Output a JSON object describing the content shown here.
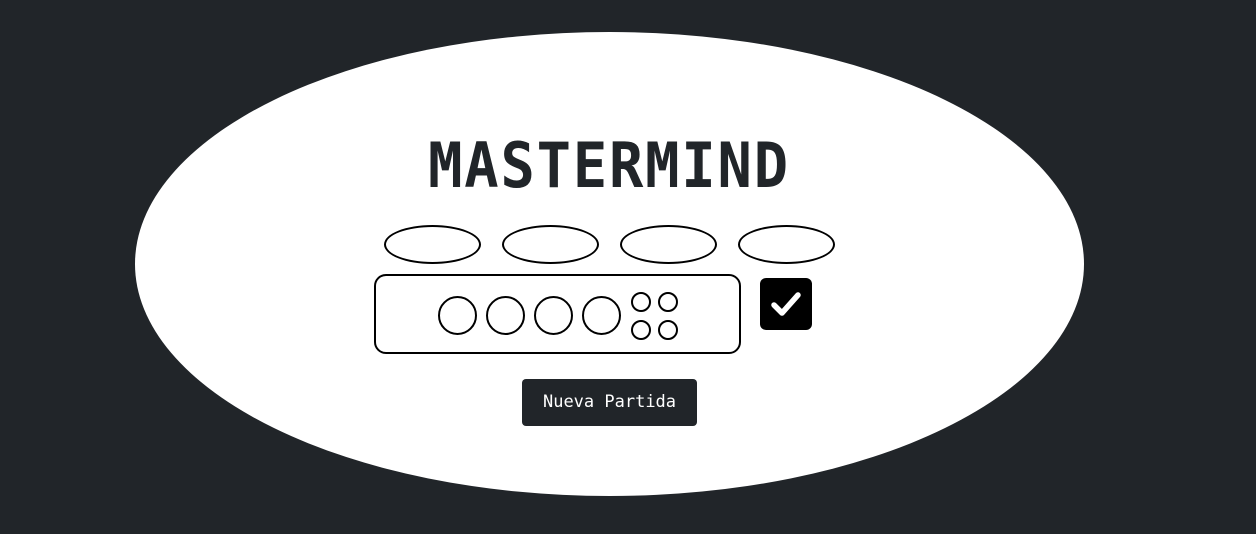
{
  "game": {
    "title": "MASTERMIND",
    "secret_slots": [
      "empty",
      "empty",
      "empty",
      "empty"
    ],
    "current_guess": {
      "pegs": [
        "empty",
        "empty",
        "empty",
        "empty"
      ],
      "hints": [
        "empty",
        "empty",
        "empty",
        "empty"
      ]
    },
    "check_icon": "check-icon",
    "new_game_label": "Nueva Partida"
  },
  "colors": {
    "background": "#212529",
    "board": "#ffffff",
    "outline": "#000000",
    "button": "#212529",
    "button_text": "#ffffff"
  }
}
